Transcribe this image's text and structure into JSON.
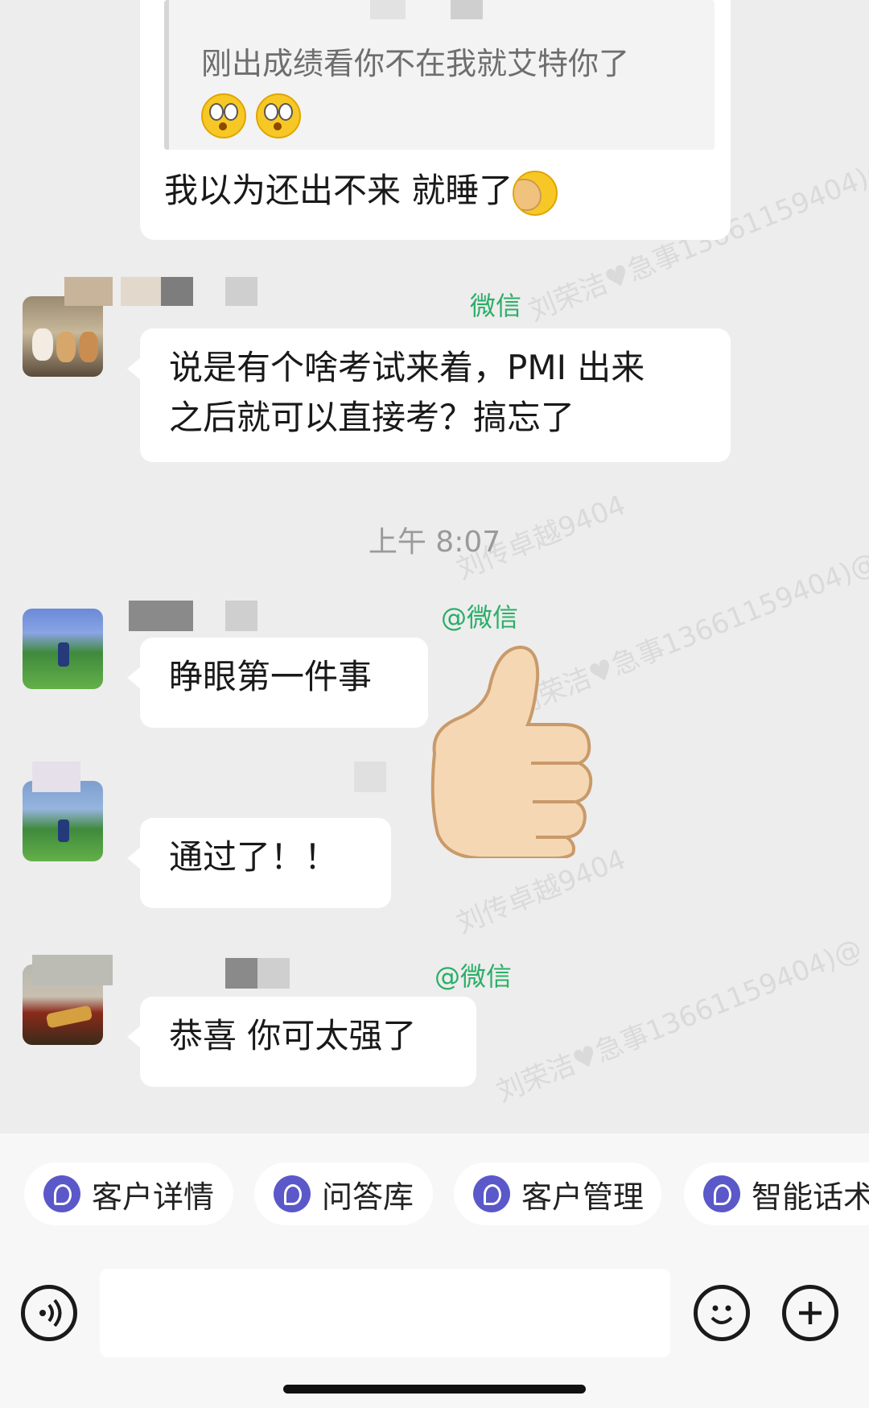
{
  "messages": [
    {
      "quote": "刚出成绩看你不在我就艾特你了",
      "text": "我以为还出不来 就睡了"
    },
    {
      "tag": "微信",
      "text_line1": "说是有个啥考试来着，PMI 出来",
      "text_line2": "之后就可以直接考？搞忘了"
    },
    {
      "tag": "@微信",
      "text": "睁眼第一件事"
    },
    {
      "text": "通过了！！"
    },
    {
      "tag": "@微信",
      "text": "恭喜 你可太强了"
    }
  ],
  "time_divider": "上午 8:07",
  "icons": {
    "thumbs_up": "thumbs-up-icon",
    "voice": "voice-icon",
    "emoji": "emoji-icon",
    "plus": "plus-icon",
    "quote_emoji": "flushed-face-icon",
    "facepalm": "facepalm-icon"
  },
  "quick_actions": [
    "客户详情",
    "问答库",
    "客户管理",
    "智能话术"
  ],
  "input": {
    "value": ""
  },
  "colors": {
    "background": "#ededed",
    "bubble": "#ffffff",
    "tag_green": "#2aae67",
    "chip_icon": "#5b58c9"
  }
}
